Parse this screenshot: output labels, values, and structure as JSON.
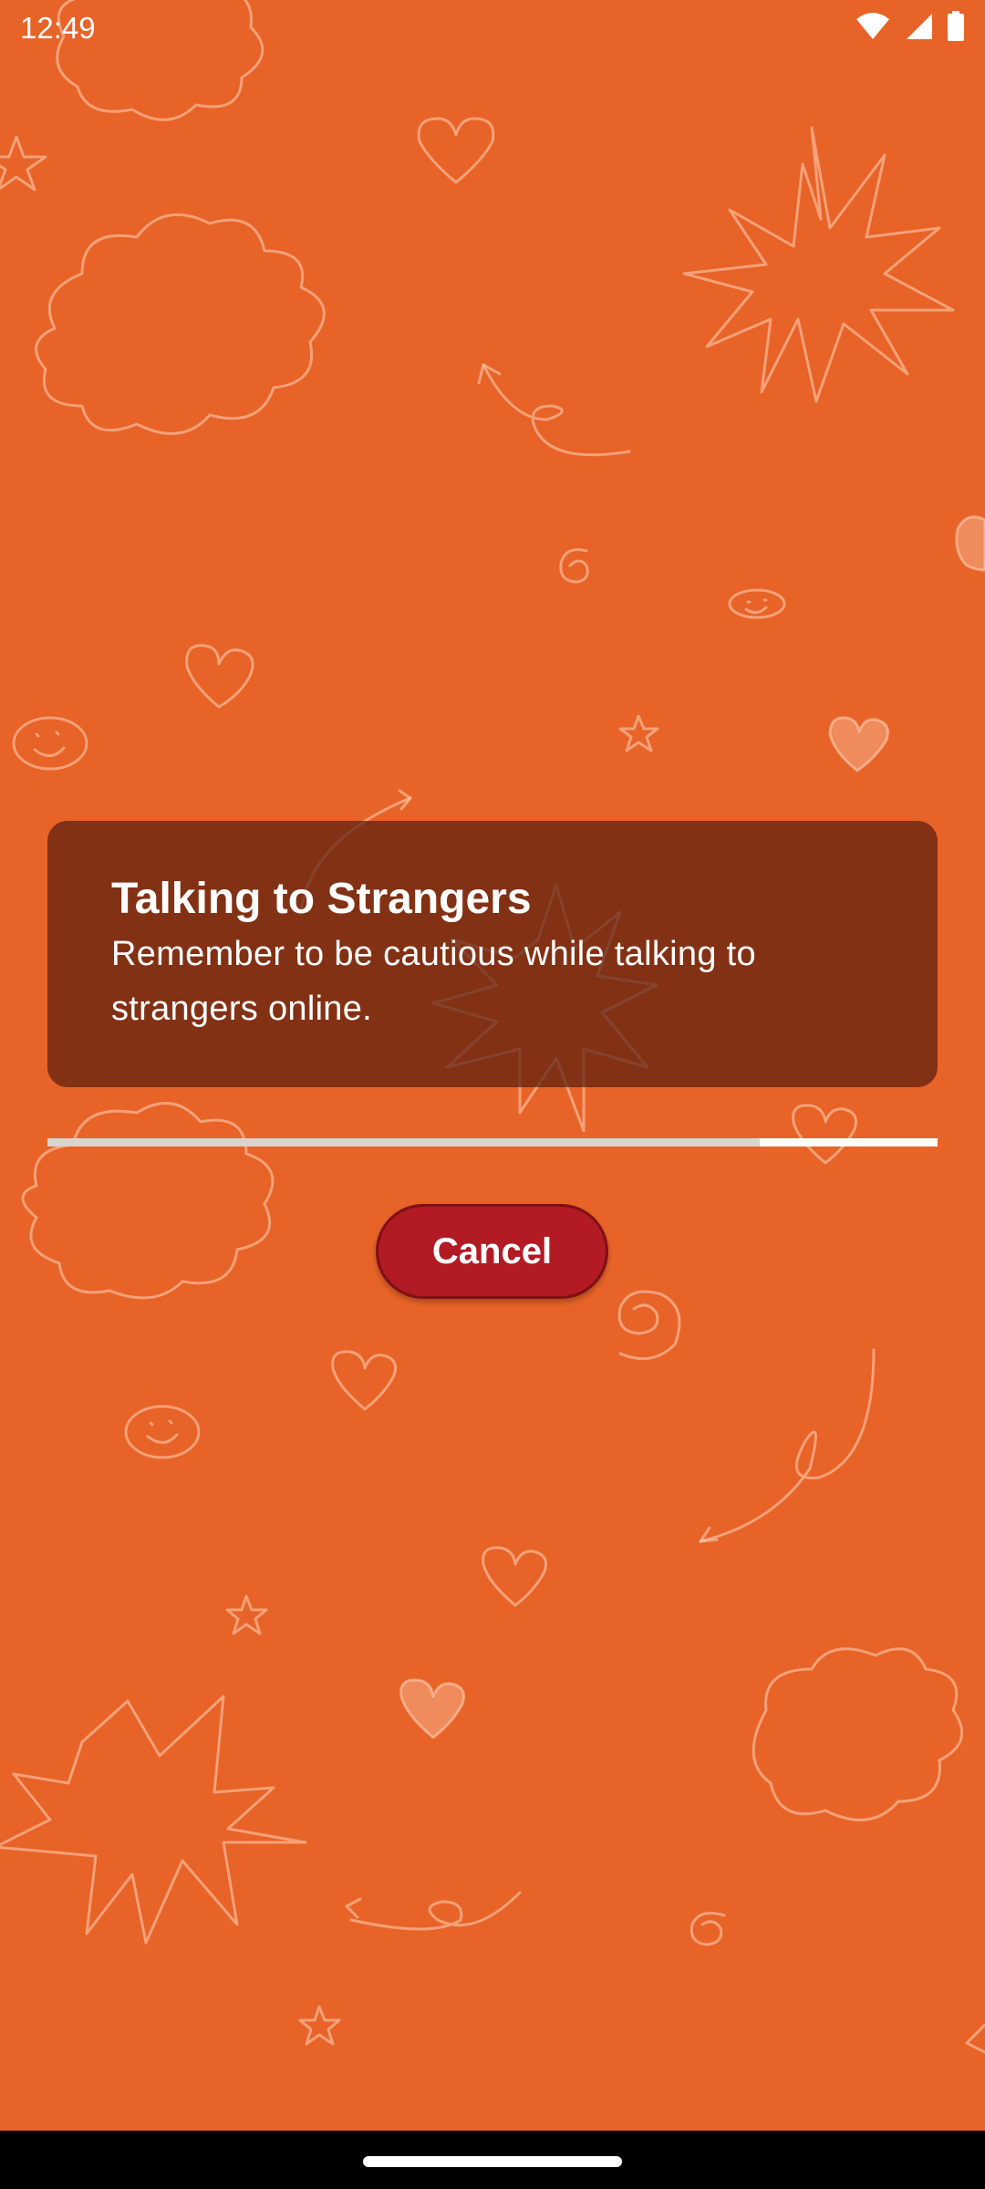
{
  "status_bar": {
    "time": "12:49",
    "icons": [
      "wifi-icon",
      "cellular-signal-icon",
      "battery-icon"
    ]
  },
  "message": {
    "title": "Talking to Strangers",
    "body": "Remember to be cautious while talking to strangers online."
  },
  "progress": {
    "fraction_complete": 0.8
  },
  "actions": {
    "cancel_label": "Cancel"
  },
  "colors": {
    "background": "#E86327",
    "card": "#5A1E0F",
    "button": "#B21A24",
    "progress_track": "#FFFFFF",
    "progress_fill": "#D9D4D1"
  }
}
